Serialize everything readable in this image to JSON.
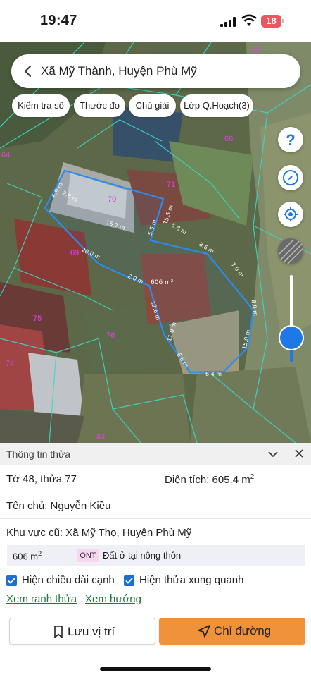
{
  "status_bar": {
    "time": "19:47",
    "battery": "18"
  },
  "search": {
    "title": "Xã Mỹ Thành, Huyện Phù Mỹ"
  },
  "chips": [
    "Kiểm tra số",
    "Thước đo",
    "Chú giải",
    "Lớp Q.Hoạch(3)"
  ],
  "map": {
    "plot_numbers": [
      "62",
      "64",
      "66",
      "71",
      "70",
      "69",
      "75",
      "76",
      "74",
      "83"
    ],
    "dimensions": [
      "6.9 m",
      "2.8 m",
      "16.7 m",
      "5.5 m",
      "15.5 m",
      "5.8 m",
      "8.6 m",
      "7.0 m",
      "8.0 m",
      "20.0 m",
      "2.0 m",
      "12.6 m",
      "11.0 m",
      "15.0 m",
      "6.6 m",
      "6.4 m"
    ],
    "area_label": "606 m²",
    "controls": {
      "help_icon": "help-icon",
      "compass_icon": "compass-icon",
      "locate_icon": "locate-icon",
      "layers_icon": "satellite-layer-icon"
    }
  },
  "panel": {
    "title": "Thông tin thửa",
    "sheet_parcel": "Tờ 48, thửa 77",
    "area_label": "Diện tích: 605.4 m",
    "area_sup": "2",
    "owner": "Tên chủ: Nguyễn Kiều",
    "old_area": "Khu vực cũ: Xã Mỹ Thọ, Huyện Phù Mỹ",
    "landuse": {
      "area": "606 m",
      "area_sup": "2",
      "code": "ONT",
      "description": "Đất ở tại nông thôn"
    },
    "checkbox_edges": "Hiện chiều dài cạnh",
    "checkbox_neighbors": "Hiện thửa xung quanh",
    "link_boundary": "Xem ranh thửa",
    "link_direction": "Xem hướng",
    "save_label": "Lưu vị trí",
    "directions_label": "Chỉ đường"
  },
  "colors": {
    "accent": "#1e78e6",
    "directions_button": "#f0923a",
    "link": "#1a7a3a",
    "plot_number": "#e040e0"
  }
}
